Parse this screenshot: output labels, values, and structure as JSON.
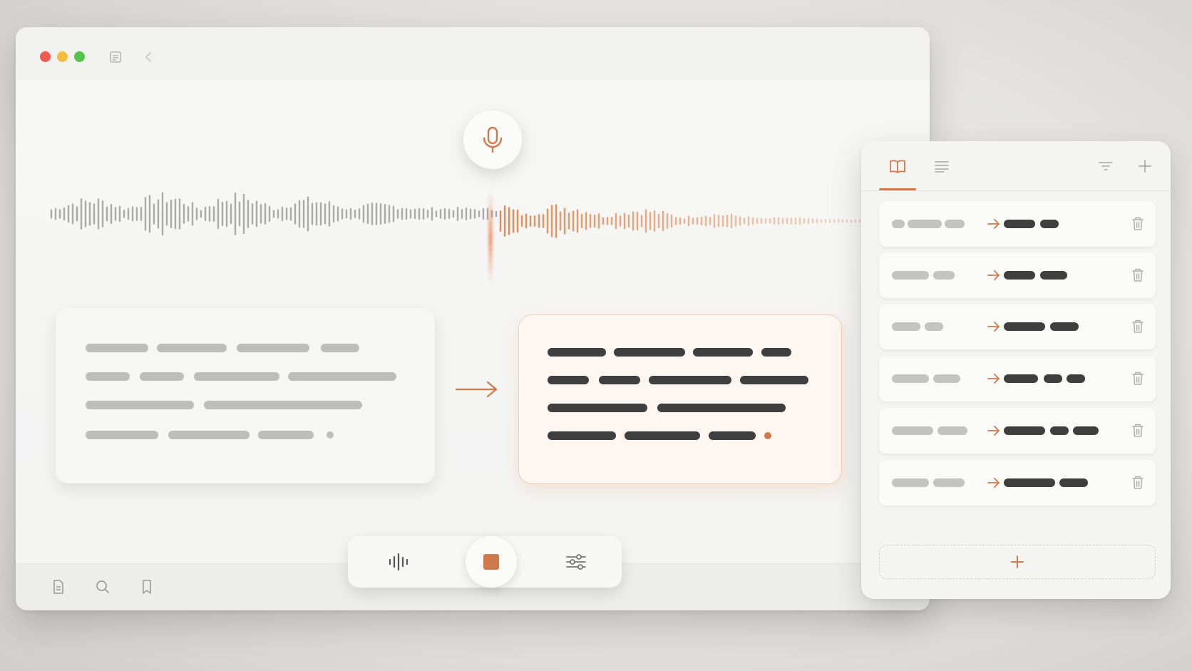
{
  "window": {
    "traffic_lights": [
      {
        "name": "close",
        "color": "#ee5b50"
      },
      {
        "name": "minimize",
        "color": "#f3bd3f"
      },
      {
        "name": "zoom",
        "color": "#55c24b"
      }
    ],
    "titlebar_icons": [
      "sidebar-document-icon",
      "back-chevron-icon"
    ],
    "bottom_icons": [
      "document-icon",
      "search-icon",
      "bookmark-icon"
    ]
  },
  "recorder": {
    "mic_icon": "microphone-icon",
    "progress": 0.55,
    "colors": {
      "accent": "#cf7a4c",
      "waveform_played": "#9d9d9c",
      "waveform_active": "#e48a55"
    }
  },
  "transcript": {
    "source_lines": 4,
    "target_lines": 4,
    "arrow_icon": "arrow-right-icon"
  },
  "controls": {
    "left_icon": "waveform-icon",
    "center_icon": "stop-icon",
    "right_icon": "sliders-icon"
  },
  "panel": {
    "tabs": [
      "book-icon",
      "list-filter-icon"
    ],
    "actions": [
      "filter-icon",
      "plus-icon"
    ],
    "active_tab": 0,
    "rows": 6,
    "add_icon": "plus-icon"
  }
}
